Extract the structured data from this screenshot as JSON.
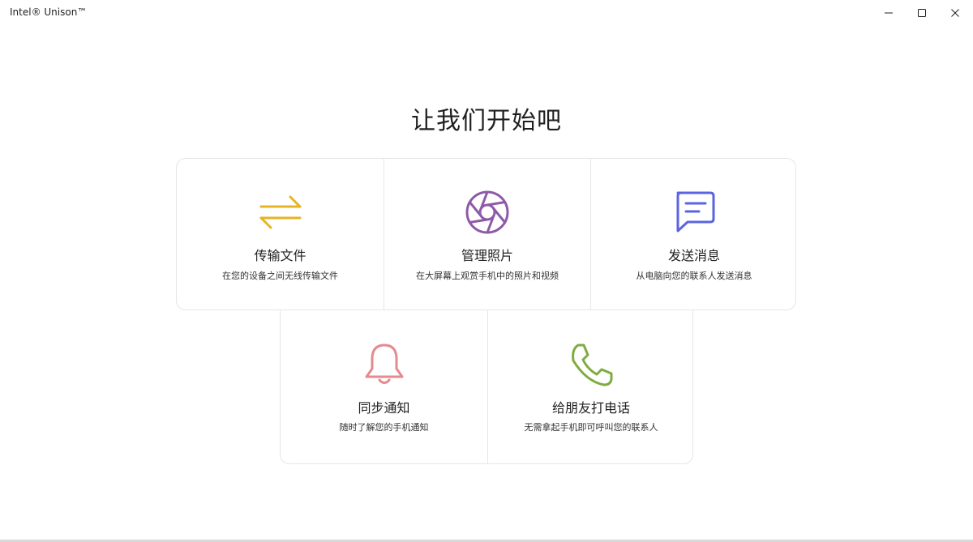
{
  "window": {
    "title": "Intel® Unison™"
  },
  "main": {
    "heading": "让我们开始吧",
    "cards": [
      {
        "title": "传输文件",
        "description": "在您的设备之间无线传输文件",
        "icon": "transfer-arrows-icon",
        "color": "#e6b424"
      },
      {
        "title": "管理照片",
        "description": "在大屏幕上观赏手机中的照片和视频",
        "icon": "camera-aperture-icon",
        "color": "#8e5aa8"
      },
      {
        "title": "发送消息",
        "description": "从电脑向您的联系人发送消息",
        "icon": "message-bubble-icon",
        "color": "#5b64e0"
      },
      {
        "title": "同步通知",
        "description": "随时了解您的手机通知",
        "icon": "bell-icon",
        "color": "#e58a8f"
      },
      {
        "title": "给朋友打电话",
        "description": "无需拿起手机即可呼叫您的联系人",
        "icon": "phone-icon",
        "color": "#7fab3f"
      }
    ]
  }
}
